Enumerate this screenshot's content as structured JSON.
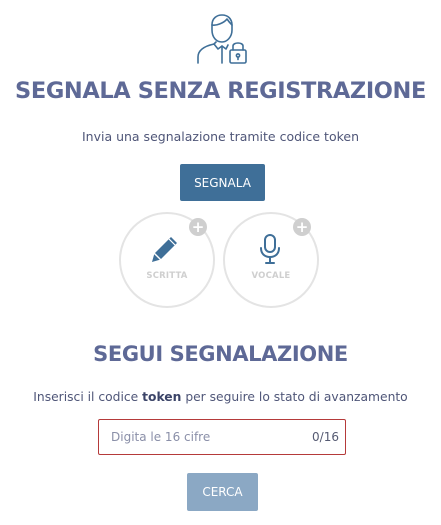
{
  "hero": {
    "icon": "user-lock-icon"
  },
  "anonymous_report": {
    "title": "SEGNALA SENZA REGISTRAZIONE",
    "subtitle": "Invia una segnalazione tramite codice token",
    "button_label": "SEGNALA",
    "options": [
      {
        "label": "SCRITTA",
        "icon": "pencil-icon",
        "badge": "+"
      },
      {
        "label": "VOCALE",
        "icon": "microphone-icon",
        "badge": "+"
      }
    ]
  },
  "follow_report": {
    "title": "SEGUI SEGNALAZIONE",
    "subtitle_before": "Inserisci il codice ",
    "subtitle_bold": "token",
    "subtitle_after": " per seguire lo stato di avanzamento",
    "input_placeholder": "Digita le 16 cifre",
    "input_value": "",
    "counter": "0/16",
    "button_label": "CERCA"
  },
  "colors": {
    "title": "#5e6996",
    "primary_button": "#3f6f98",
    "disabled_button": "#8ba8c4",
    "input_border_error": "#b53a3a",
    "circle_border": "#e4e4e4",
    "option_icon": "#3f6f98"
  }
}
